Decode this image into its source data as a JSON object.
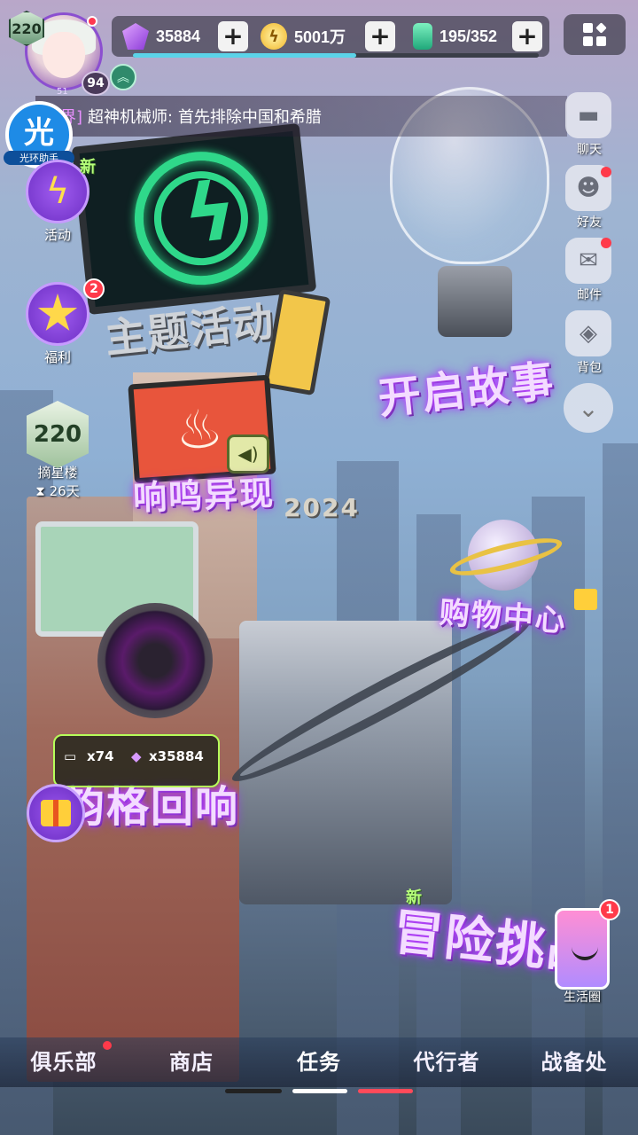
{
  "player": {
    "level": "220",
    "rank_number": "94",
    "sub_number": "51"
  },
  "currencies": [
    {
      "icon": "gem-icon",
      "value": "35884"
    },
    {
      "icon": "coin-icon",
      "value": "5001万"
    },
    {
      "icon": "battery-icon",
      "value": "195/352"
    }
  ],
  "energy_progress": 0.55,
  "ticker": {
    "tag": "界]",
    "text": "超神机械师: 首先排除中国和希腊"
  },
  "helper": {
    "glyph": "光",
    "label": "光环助手"
  },
  "left_menu": {
    "activity": {
      "label": "活动",
      "badge": "新"
    },
    "welfare": {
      "label": "福利",
      "count": "2"
    },
    "star_tower": {
      "label": "摘星楼",
      "level": "220",
      "days": "26天"
    }
  },
  "right_menu": [
    {
      "icon": "chat-icon",
      "label": "聊天",
      "dot": false
    },
    {
      "icon": "friends-icon",
      "label": "好友",
      "dot": true
    },
    {
      "icon": "mail-icon",
      "label": "邮件",
      "dot": true
    },
    {
      "icon": "bag-icon",
      "label": "背包",
      "dot": false
    }
  ],
  "world_labels": {
    "theme": "主题活动",
    "story": "开启故事",
    "music": "响鸣异现",
    "year": "2024",
    "shop": "购物中心",
    "echo": "韵格回响",
    "adventure": "冒险挑战",
    "adventure_badge": "新"
  },
  "rewards": {
    "ticket_count": "x74",
    "gem_count": "x35884"
  },
  "life_circle": {
    "label": "生活圈",
    "count": "1"
  },
  "bottom_nav": [
    {
      "label": "俱乐部",
      "dot": true
    },
    {
      "label": "商店",
      "dot": false
    },
    {
      "label": "任务",
      "dot": false
    },
    {
      "label": "代行者",
      "dot": false
    },
    {
      "label": "战备处",
      "dot": false
    }
  ],
  "colors": {
    "accent_purple": "#9b2bff",
    "neon_green": "#2fd88a",
    "alert_red": "#ff3a4a"
  }
}
